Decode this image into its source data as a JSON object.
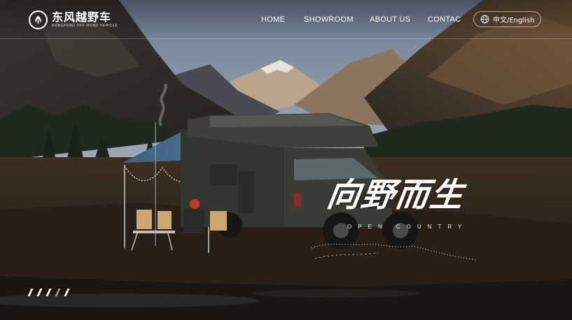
{
  "brand": {
    "name_cn": "东风越野车",
    "name_en": "DONGFENG OFF-ROAD VEHICLE",
    "logo_icon": "dongfeng-swallow-logo"
  },
  "nav": {
    "items": [
      {
        "label": "HOME"
      },
      {
        "label": "SHOWROOM"
      },
      {
        "label": "ABOUT US"
      },
      {
        "label": "CONTAC"
      }
    ]
  },
  "language": {
    "icon": "globe-icon",
    "label": "中文/English"
  },
  "hero": {
    "slogan_cn": "向野而生",
    "slogan_en": "OPEN COUNTRY"
  },
  "carousel": {
    "slide_count": 5,
    "active_index": 3
  },
  "colors": {
    "text": "#ffffff",
    "sky": "#8a9ab0",
    "ground": "#3b2c1e",
    "awning": "#4a6e92",
    "vehicle": "#3d3f3a"
  }
}
